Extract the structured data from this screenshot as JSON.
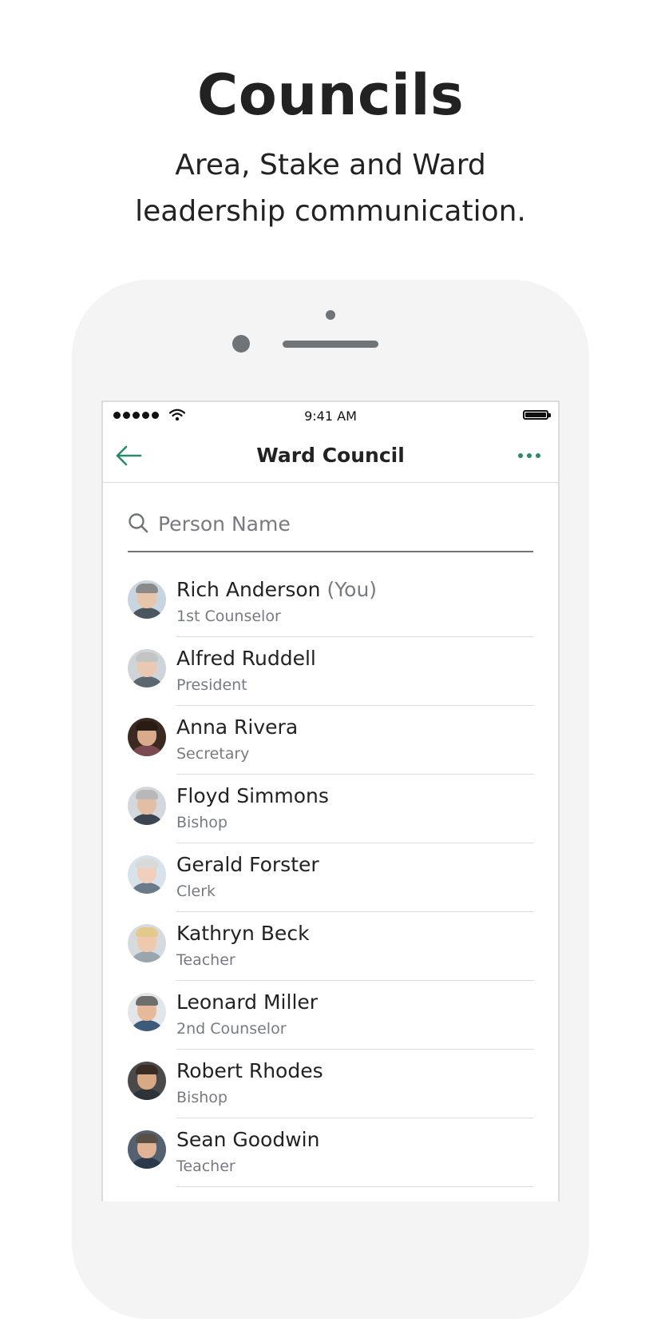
{
  "promo": {
    "title": "Councils",
    "subtitle_line1": "Area, Stake and Ward",
    "subtitle_line2": "leadership communication."
  },
  "status_bar": {
    "time": "9:41 AM"
  },
  "nav": {
    "title": "Ward Council",
    "back_icon": "arrow-left-icon",
    "more_icon": "more-dots-icon",
    "accent_color": "#2b8a6a"
  },
  "search": {
    "placeholder": "Person Name",
    "value": ""
  },
  "people": [
    {
      "name": "Rich Anderson",
      "suffix": "(You)",
      "role": "1st Counselor",
      "skin": "#e8c4a8",
      "hair": "#8a8a8a",
      "shirt": "#4a5660",
      "bg": "#c9d5de"
    },
    {
      "name": "Alfred Ruddell",
      "suffix": "",
      "role": "President",
      "skin": "#e9c9b4",
      "hair": "#c4c4c4",
      "shirt": "#5c6670",
      "bg": "#cfd4d8"
    },
    {
      "name": "Anna Rivera",
      "suffix": "",
      "role": "Secretary",
      "skin": "#d9ab8c",
      "hair": "#2a1c14",
      "shirt": "#7a4a52",
      "bg": "#3a2a22"
    },
    {
      "name": "Floyd Simmons",
      "suffix": "",
      "role": "Bishop",
      "skin": "#e2bfa4",
      "hair": "#b8b8b8",
      "shirt": "#3d4650",
      "bg": "#d4d8dc"
    },
    {
      "name": "Gerald Forster",
      "suffix": "",
      "role": "Clerk",
      "skin": "#f0d0bc",
      "hair": "#d9d9d9",
      "shirt": "#6a7a88",
      "bg": "#d8e2ea"
    },
    {
      "name": "Kathryn Beck",
      "suffix": "",
      "role": "Teacher",
      "skin": "#eec9ad",
      "hair": "#e3c98a",
      "shirt": "#9aa6ae",
      "bg": "#d6dadc"
    },
    {
      "name": "Leonard Miller",
      "suffix": "",
      "role": "2nd Counselor",
      "skin": "#e5b99a",
      "hair": "#6e6e6e",
      "shirt": "#3c5a7a",
      "bg": "#e3e6e8"
    },
    {
      "name": "Robert Rhodes",
      "suffix": "",
      "role": "Bishop",
      "skin": "#d9a985",
      "hair": "#3a2c24",
      "shirt": "#2e3338",
      "bg": "#4a4a4a"
    },
    {
      "name": "Sean Goodwin",
      "suffix": "",
      "role": "Teacher",
      "skin": "#e0b394",
      "hair": "#5a5048",
      "shirt": "#2a3a4a",
      "bg": "#556070"
    }
  ]
}
